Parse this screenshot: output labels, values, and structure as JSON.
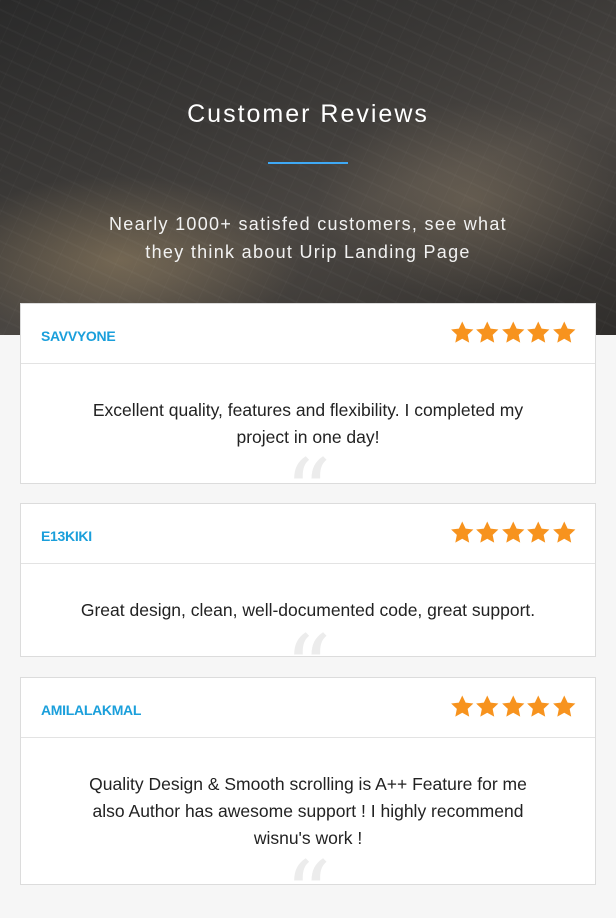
{
  "hero": {
    "title": "Customer Reviews",
    "subtitle": "Nearly 1000+ satisfed customers, see what they think about Urip Landing Page",
    "accent_color": "#3fa9f5"
  },
  "quote_glyph": "“",
  "star_color": "#f7931e",
  "reviews": [
    {
      "author": "SAVVYONE",
      "rating": 5,
      "text": "Excellent quality, features and flexibility. I completed my project in one day!"
    },
    {
      "author": "E13KIKI",
      "rating": 5,
      "text": "Great design, clean, well-documented code, great support."
    },
    {
      "author": "AMILALAKMAL",
      "rating": 5,
      "text": "Quality Design & Smooth scrolling is A++ Feature for me also Author has awesome support ! I highly recommend wisnu's work !"
    }
  ]
}
